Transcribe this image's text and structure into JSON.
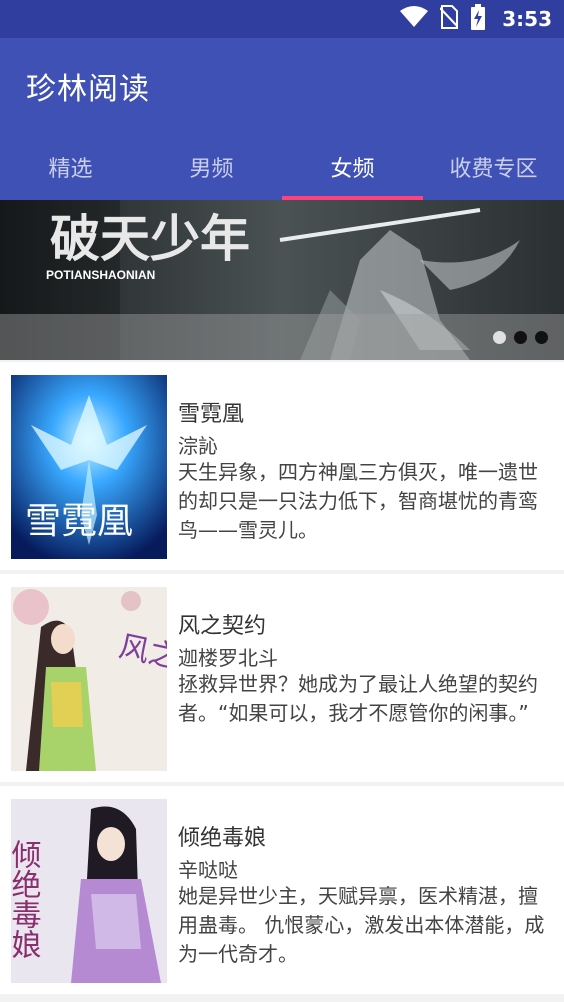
{
  "status_bar": {
    "time": "3:53"
  },
  "app_bar": {
    "title": "珍林阅读"
  },
  "tabs": [
    {
      "label": "精选"
    },
    {
      "label": "男频"
    },
    {
      "label": "女频"
    },
    {
      "label": "收费专区"
    }
  ],
  "active_tab_index": 2,
  "banner": {
    "title_art_text": "破天少年",
    "subtitle": "POTIANSHAONIAN",
    "page_count": 3,
    "current_page": 3
  },
  "books": [
    {
      "title": "雪霓凰",
      "author": "淙訫",
      "description": "天生异象，四方神凰三方俱灭，唯一遗世的却只是一只法力低下，智商堪忧的青鸾鸟——雪灵儿。",
      "cover_text": "雪霓凰"
    },
    {
      "title": "风之契约",
      "author": "迦楼罗北斗",
      "description": "拯救异世界？她成为了最让人绝望的契约者。“如果可以，我才不愿管你的闲事。”",
      "cover_text": "风之契约"
    },
    {
      "title": "倾绝毒娘",
      "author": "辛哒哒",
      "description": "她是异世少主，天赋异禀，医术精湛，擅用蛊毒。 仇恨蒙心，激发出本体潜能，成为一代奇才。",
      "cover_text": "倾绝毒娘"
    }
  ],
  "colors": {
    "status_bar": "#303f9f",
    "app_bar": "#3f51b5",
    "tab_indicator": "#ff4081"
  }
}
